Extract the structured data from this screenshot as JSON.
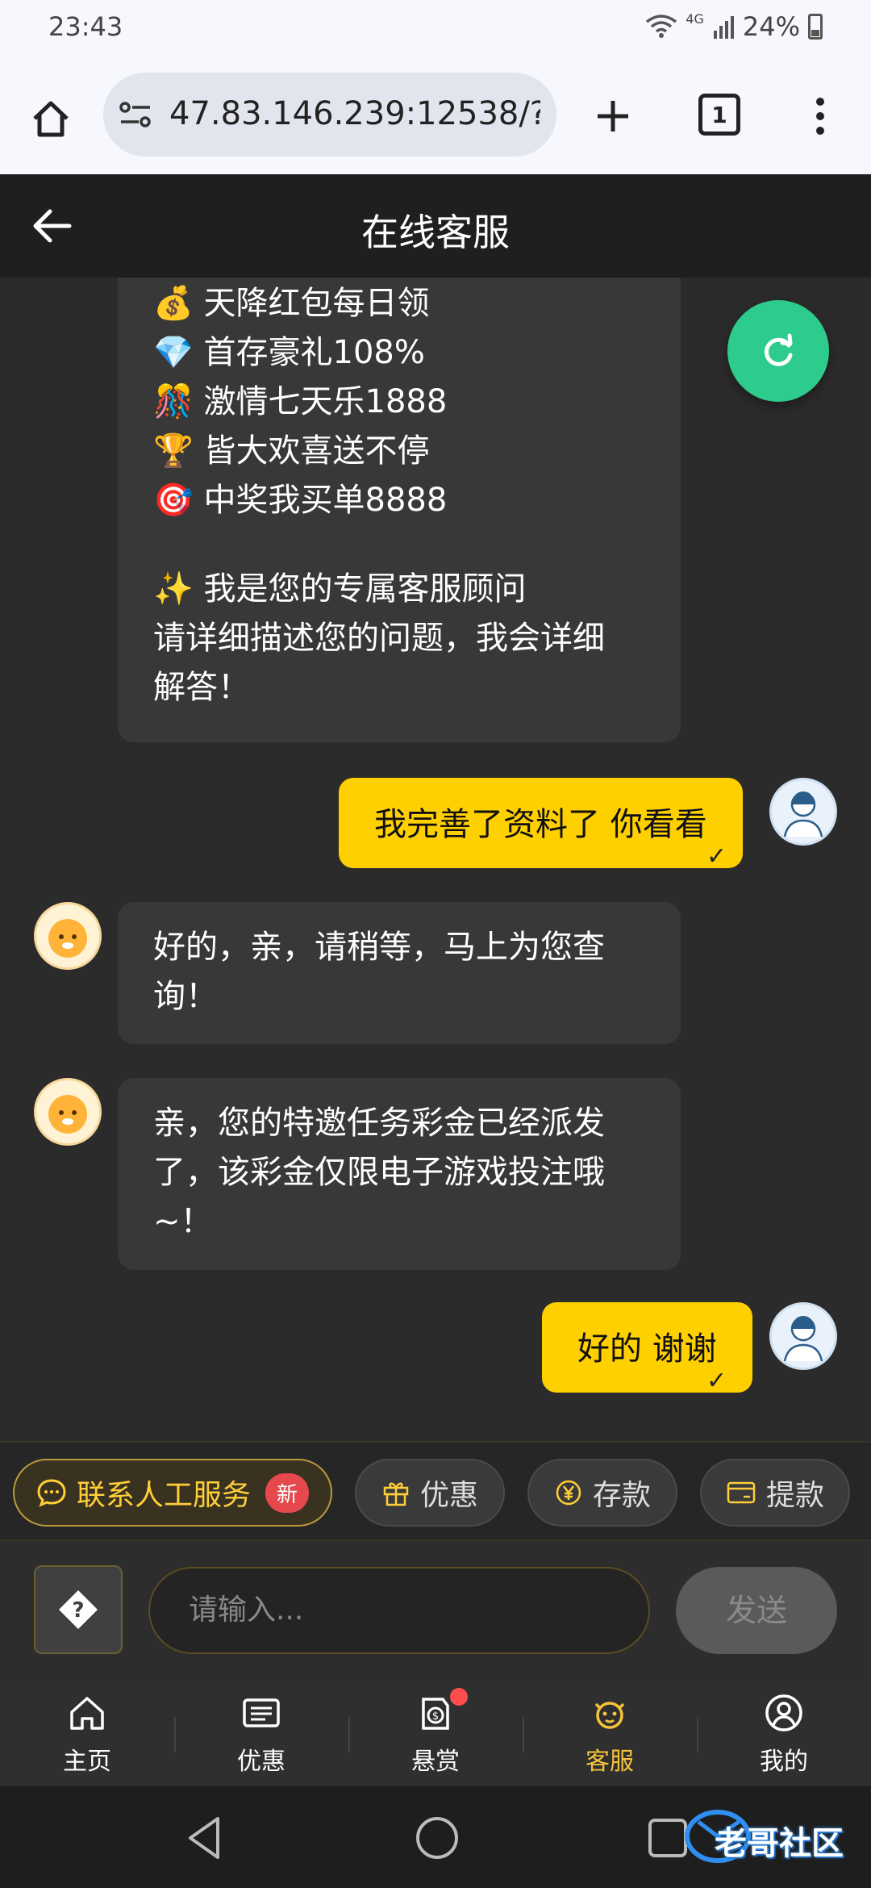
{
  "status_bar": {
    "time": "23:43",
    "network": "4G",
    "battery": "24%"
  },
  "browser": {
    "url": "47.83.146.239:12538/?",
    "tab_count": "1"
  },
  "header": {
    "title": "在线客服"
  },
  "messages": [
    {
      "from": "bot",
      "lines": [
        "💰 天降红包每日领",
        "💎 首存豪礼108%",
        "🎊 激情七天乐1888",
        "🏆 皆大欢喜送不停",
        "🎯 中奖我买单8888",
        "",
        "✨ 我是您的专属客服顾问",
        "请详细描述您的问题，我会详细",
        "解答！"
      ]
    },
    {
      "from": "user",
      "text": "我完善了资料了 你看看"
    },
    {
      "from": "bot",
      "text": "好的，亲，请稍等，马上为您查询！"
    },
    {
      "from": "bot",
      "text": "亲，您的特邀任务彩金已经派发了，该彩金仅限电子游戏投注哦~！"
    },
    {
      "from": "user",
      "text": "好的 谢谢"
    }
  ],
  "quick_actions": {
    "human": "联系人工服务",
    "new_badge": "新",
    "promo": "优惠",
    "deposit": "存款",
    "withdraw": "提款"
  },
  "input": {
    "placeholder": "请输入...",
    "send": "发送"
  },
  "nav": {
    "home": "主页",
    "promo": "优惠",
    "reward": "悬赏",
    "service": "客服",
    "mine": "我的"
  },
  "watermark": "老哥社区",
  "colors": {
    "accent": "#ffd000",
    "refresh": "#2ecc8c",
    "active_nav": "#f5c23a"
  }
}
